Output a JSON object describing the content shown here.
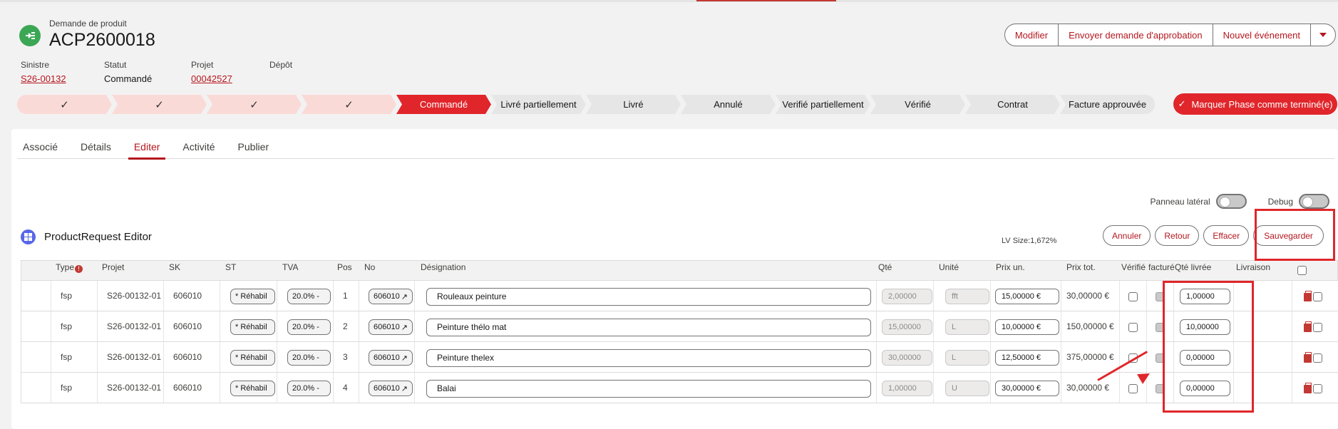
{
  "record": {
    "object_type": "Demande de produit",
    "name": "ACP2600018",
    "actions": [
      "Modifier",
      "Envoyer demande d'approbation",
      "Nouvel événement"
    ],
    "more_icon": "chevron-down-icon",
    "fields": [
      {
        "label": "Sinistre",
        "value": "S26-00132",
        "link": true
      },
      {
        "label": "Statut",
        "value": "Commandé",
        "link": false
      },
      {
        "label": "Projet",
        "value": "00042527",
        "link": true
      },
      {
        "label": "Dépôt",
        "value": "",
        "link": false
      }
    ]
  },
  "path": {
    "steps": [
      {
        "label": "",
        "state": "done"
      },
      {
        "label": "",
        "state": "done"
      },
      {
        "label": "",
        "state": "done"
      },
      {
        "label": "",
        "state": "done"
      },
      {
        "label": "Commandé",
        "state": "current"
      },
      {
        "label": "Livré partiellement",
        "state": "todo"
      },
      {
        "label": "Livré",
        "state": "todo"
      },
      {
        "label": "Annulé",
        "state": "todo"
      },
      {
        "label": "Verifié partiellement",
        "state": "todo"
      },
      {
        "label": "Vérifié",
        "state": "todo"
      },
      {
        "label": "Contrat",
        "state": "todo"
      },
      {
        "label": "Facture approuvée",
        "state": "todo"
      }
    ],
    "complete_button": "Marquer Phase comme terminé(e)"
  },
  "tabs": [
    {
      "label": "Associé",
      "active": false
    },
    {
      "label": "Détails",
      "active": false
    },
    {
      "label": "Editer",
      "active": true
    },
    {
      "label": "Activité",
      "active": false
    },
    {
      "label": "Publier",
      "active": false
    }
  ],
  "toggles": {
    "side_panel": "Panneau latéral",
    "debug": "Debug"
  },
  "editor": {
    "title": "ProductRequest Editor",
    "lv_size": "LV Size:1,672%",
    "buttons": {
      "cancel": "Annuler",
      "back": "Retour",
      "clear": "Effacer",
      "save": "Sauvegarder"
    }
  },
  "table": {
    "headers": {
      "type": "Type",
      "projet": "Projet",
      "sk": "SK",
      "st": "ST",
      "tva": "TVA",
      "pos": "Pos",
      "no": "No",
      "designation": "Désignation",
      "qte": "Qté",
      "unite": "Unité",
      "prix_un": "Prix un.",
      "prix_tot": "Prix tot.",
      "verifie": "Vérifié",
      "facture": "facturé",
      "qte_livree": "Qté livrée",
      "livraison": "Livraison"
    },
    "rows": [
      {
        "type": "fsp",
        "projet": "S26-00132-01",
        "sk": "606010",
        "st": "* Réhabil",
        "tva": "20.0% - ",
        "pos": "1",
        "no": "606010",
        "designation": "Rouleaux peinture",
        "qte": "2,00000",
        "unite": "fft",
        "prix_un": "15,00000 €",
        "prix_tot": "30,00000 €",
        "qte_livree": "1,00000"
      },
      {
        "type": "fsp",
        "projet": "S26-00132-01",
        "sk": "606010",
        "st": "* Réhabil",
        "tva": "20.0% - ",
        "pos": "2",
        "no": "606010",
        "designation": "Peinture thélo mat",
        "qte": "15,00000",
        "unite": "L",
        "prix_un": "10,00000 €",
        "prix_tot": "150,00000 €",
        "qte_livree": "10,00000"
      },
      {
        "type": "fsp",
        "projet": "S26-00132-01",
        "sk": "606010",
        "st": "* Réhabil",
        "tva": "20.0% - ",
        "pos": "3",
        "no": "606010",
        "designation": "Peinture thelex",
        "qte": "30,00000",
        "unite": "L",
        "prix_un": "12,50000 €",
        "prix_tot": "375,00000 €",
        "qte_livree": "0,00000"
      },
      {
        "type": "fsp",
        "projet": "S26-00132-01",
        "sk": "606010",
        "st": "* Réhabil",
        "tva": "20.0% - ",
        "pos": "4",
        "no": "606010",
        "designation": "Balai",
        "qte": "1,00000",
        "unite": "U",
        "prix_un": "30,00000 €",
        "prix_tot": "30,00000 €",
        "qte_livree": "0,00000"
      }
    ]
  },
  "colors": {
    "brand": "#b4171f",
    "accent": "#e0262b",
    "highlight": "#e0262b"
  }
}
